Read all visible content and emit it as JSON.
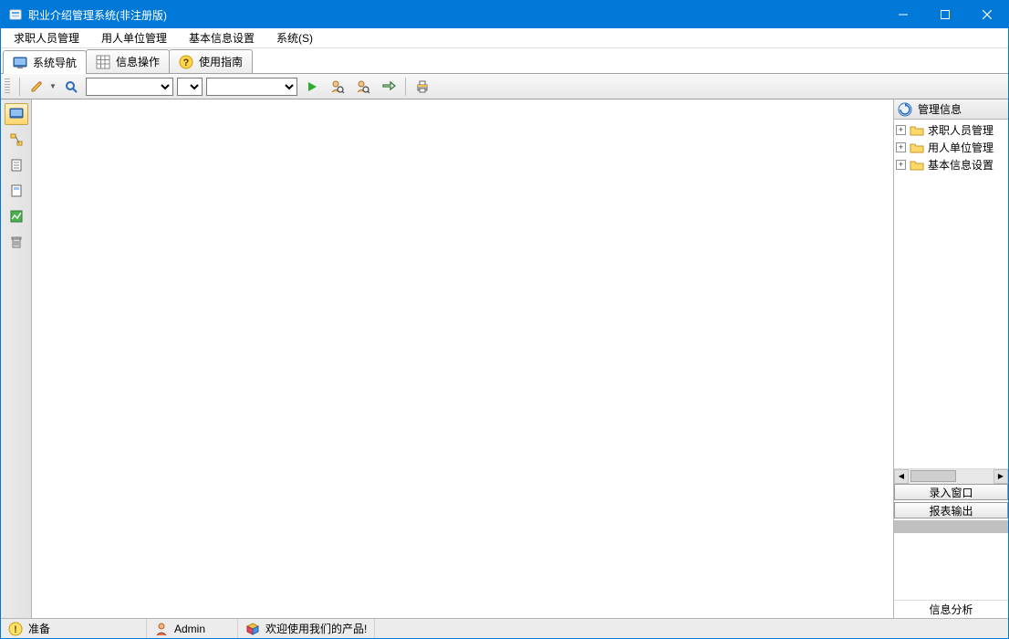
{
  "window": {
    "title": "职业介绍管理系统(非注册版)"
  },
  "menu": {
    "items": [
      "求职人员管理",
      "用人单位管理",
      "基本信息设置",
      "系统(S)"
    ]
  },
  "tabs": [
    {
      "label": "系统导航",
      "icon": "monitor-icon"
    },
    {
      "label": "信息操作",
      "icon": "grid-icon"
    },
    {
      "label": "使用指南",
      "icon": "help-icon"
    }
  ],
  "right_panel": {
    "header": "管理信息",
    "tree": [
      {
        "label": "求职人员管理"
      },
      {
        "label": "用人单位管理"
      },
      {
        "label": "基本信息设置"
      }
    ],
    "buttons": {
      "input_window": "录入窗口",
      "report_output": "报表输出"
    },
    "footer": "信息分析"
  },
  "status": {
    "ready": "准备",
    "user": "Admin",
    "welcome": "欢迎使用我们的产品!"
  }
}
